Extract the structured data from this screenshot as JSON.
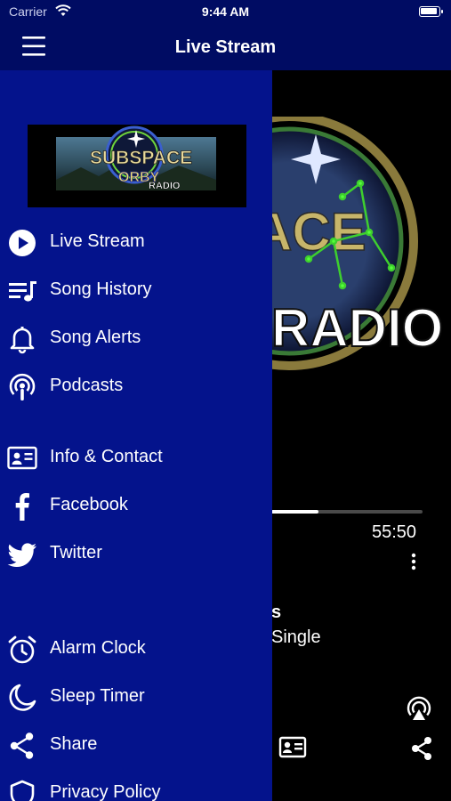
{
  "status_bar": {
    "carrier": "Carrier",
    "time": "9:44 AM"
  },
  "nav": {
    "title": "Live Stream"
  },
  "logo": {
    "line1": "SUBSPACE",
    "line2": "ORBY",
    "line3": "RADIO"
  },
  "menu": {
    "items": [
      {
        "label": "Live Stream",
        "icon": "play-circle-icon"
      },
      {
        "label": "Song History",
        "icon": "playlist-icon"
      },
      {
        "label": "Song Alerts",
        "icon": "bell-icon"
      },
      {
        "label": "Podcasts",
        "icon": "podcast-icon"
      },
      {
        "label": "Info & Contact",
        "icon": "contact-card-icon"
      },
      {
        "label": "Facebook",
        "icon": "facebook-icon"
      },
      {
        "label": "Twitter",
        "icon": "twitter-icon"
      },
      {
        "label": "Alarm Clock",
        "icon": "alarm-clock-icon"
      },
      {
        "label": "Sleep Timer",
        "icon": "moon-icon"
      },
      {
        "label": "Share",
        "icon": "share-icon"
      },
      {
        "label": "Privacy Policy",
        "icon": "shield-icon"
      }
    ]
  },
  "player": {
    "art_text": "RADIO",
    "art_partial": "ACE",
    "duration": "55:50",
    "progress": 0.31,
    "title_fragment": "s",
    "subtitle_fragment": "Single"
  },
  "colors": {
    "bar": "#000c63",
    "drawer": "#04138c",
    "player_bg": "#000000"
  }
}
